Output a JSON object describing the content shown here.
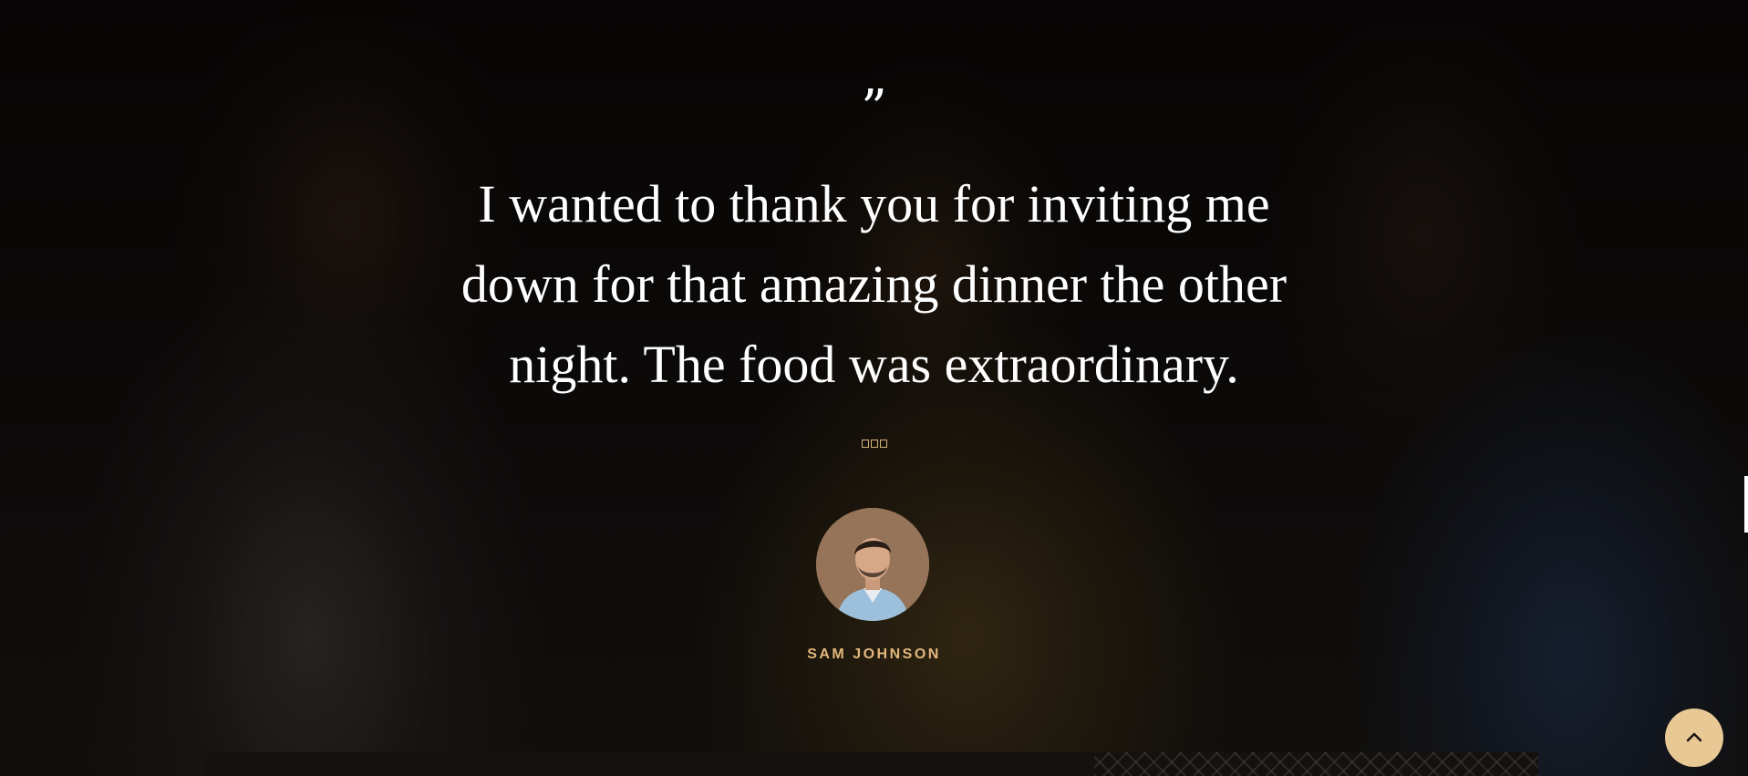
{
  "testimonial": {
    "quote_mark": "”",
    "quote_lines": [
      "I wanted to thank you for inviting me",
      "down for that amazing dinner the other",
      "night. The food was extraordinary."
    ],
    "rating": 3,
    "author_name": "SAM JOHNSON"
  },
  "icons": {
    "star": "star-outline-icon",
    "back_to_top": "chevron-up-icon"
  },
  "colors": {
    "accent": "#e3b77d",
    "button_bg": "#e8c894",
    "text": "#ffffff"
  }
}
